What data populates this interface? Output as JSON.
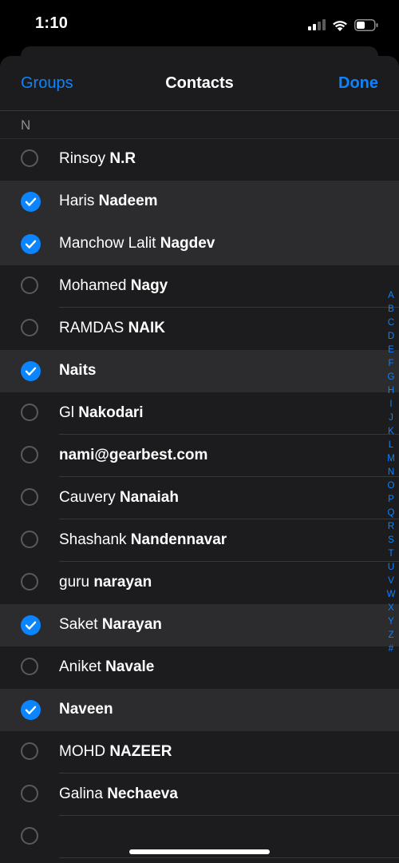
{
  "status": {
    "time": "1:10"
  },
  "nav": {
    "groups": "Groups",
    "title": "Contacts",
    "done": "Done"
  },
  "section": {
    "letter": "N"
  },
  "contacts": [
    {
      "first": "Rinsoy ",
      "last": "N.R",
      "selected": false
    },
    {
      "first": "Haris ",
      "last": "Nadeem",
      "selected": true
    },
    {
      "first": "Manchow Lalit ",
      "last": "Nagdev",
      "selected": true
    },
    {
      "first": "Mohamed ",
      "last": "Nagy",
      "selected": false
    },
    {
      "first": "RAMDAS ",
      "last": "NAIK",
      "selected": false
    },
    {
      "first": "",
      "last": "Naits",
      "selected": true
    },
    {
      "first": "Gl ",
      "last": "Nakodari",
      "selected": false
    },
    {
      "first": "",
      "last": "nami@gearbest.com",
      "selected": false
    },
    {
      "first": "Cauvery ",
      "last": "Nanaiah",
      "selected": false
    },
    {
      "first": "Shashank ",
      "last": "Nandennavar",
      "selected": false
    },
    {
      "first": "guru ",
      "last": "narayan",
      "selected": false
    },
    {
      "first": "Saket ",
      "last": "Narayan",
      "selected": true
    },
    {
      "first": "Aniket ",
      "last": "Navale",
      "selected": false
    },
    {
      "first": "",
      "last": "Naveen",
      "selected": true
    },
    {
      "first": "MOHD ",
      "last": "NAZEER",
      "selected": false
    },
    {
      "first": "Galina ",
      "last": "Nechaeva",
      "selected": false
    },
    {
      "first": "",
      "last": "",
      "selected": false
    }
  ],
  "index_letters": [
    "A",
    "B",
    "C",
    "D",
    "E",
    "F",
    "G",
    "H",
    "I",
    "J",
    "K",
    "L",
    "M",
    "N",
    "O",
    "P",
    "Q",
    "R",
    "S",
    "T",
    "U",
    "V",
    "W",
    "X",
    "Y",
    "Z",
    "#"
  ],
  "colors": {
    "accent": "#0a84ff",
    "sheet": "#1c1c1e",
    "selected_row": "#2c2c2e",
    "background": "#000000"
  }
}
